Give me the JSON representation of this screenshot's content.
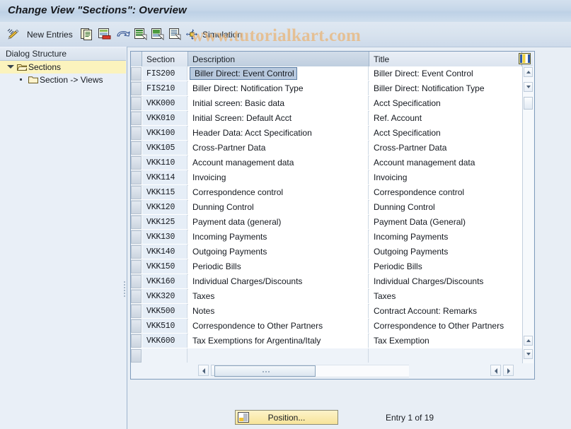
{
  "window": {
    "title": "Change View \"Sections\": Overview"
  },
  "watermark": {
    "text": "www.tutorialkart.com"
  },
  "toolbar": {
    "change_icon": "pencil-icon",
    "new_entries_label": "New Entries",
    "icons": [
      {
        "name": "copy-as-icon"
      },
      {
        "name": "delete-icon"
      },
      {
        "name": "undo-icon"
      },
      {
        "name": "select-all-icon"
      },
      {
        "name": "deselect-all-icon"
      },
      {
        "name": "select-block-icon"
      }
    ],
    "simulation_label": "Simulation",
    "simulation_icon": "simulation-icon"
  },
  "sidebar": {
    "header": "Dialog Structure",
    "items": [
      {
        "label": "Sections",
        "icon": "open-folder-icon",
        "selected": true,
        "level": 0
      },
      {
        "label": "Section -> Views",
        "icon": "folder-icon",
        "selected": false,
        "level": 1
      }
    ]
  },
  "table": {
    "columns": [
      {
        "key": "section",
        "label": "Section"
      },
      {
        "key": "description",
        "label": "Description"
      },
      {
        "key": "title",
        "label": "Title"
      }
    ],
    "settings_icon": "table-settings-icon",
    "selected_row_index": 0,
    "selected_cell": "description",
    "rows": [
      {
        "section": "FIS200",
        "description": "Biller Direct: Event Control",
        "title": "Biller Direct: Event Control"
      },
      {
        "section": "FIS210",
        "description": "Biller Direct: Notification Type",
        "title": "Biller Direct: Notification Type"
      },
      {
        "section": "VKK000",
        "description": "Initial screen: Basic data",
        "title": "Acct Specification"
      },
      {
        "section": "VKK010",
        "description": "Initial Screen: Default Acct",
        "title": "Ref. Account"
      },
      {
        "section": "VKK100",
        "description": "Header Data: Acct Specification",
        "title": "Acct Specification"
      },
      {
        "section": "VKK105",
        "description": "Cross-Partner Data",
        "title": "Cross-Partner Data"
      },
      {
        "section": "VKK110",
        "description": "Account management data",
        "title": "Account management data"
      },
      {
        "section": "VKK114",
        "description": "Invoicing",
        "title": "Invoicing"
      },
      {
        "section": "VKK115",
        "description": "Correspondence control",
        "title": "Correspondence control"
      },
      {
        "section": "VKK120",
        "description": "Dunning Control",
        "title": "Dunning Control"
      },
      {
        "section": "VKK125",
        "description": "Payment data (general)",
        "title": "Payment Data (General)"
      },
      {
        "section": "VKK130",
        "description": "Incoming Payments",
        "title": "Incoming Payments"
      },
      {
        "section": "VKK140",
        "description": "Outgoing Payments",
        "title": "Outgoing Payments"
      },
      {
        "section": "VKK150",
        "description": "Periodic Bills",
        "title": "Periodic Bills"
      },
      {
        "section": "VKK160",
        "description": "Individual Charges/Discounts",
        "title": "Individual Charges/Discounts"
      },
      {
        "section": "VKK320",
        "description": "Taxes",
        "title": "Taxes"
      },
      {
        "section": "VKK500",
        "description": "Notes",
        "title": "Contract Account: Remarks"
      },
      {
        "section": "VKK510",
        "description": "Correspondence to Other Partners",
        "title": "Correspondence to Other Partners"
      },
      {
        "section": "VKK600",
        "description": "Tax Exemptions for Argentina/Italy",
        "title": "Tax Exemption"
      }
    ]
  },
  "footer": {
    "position_label": "Position...",
    "position_icon": "position-icon",
    "entry_status": "Entry 1 of 19"
  }
}
